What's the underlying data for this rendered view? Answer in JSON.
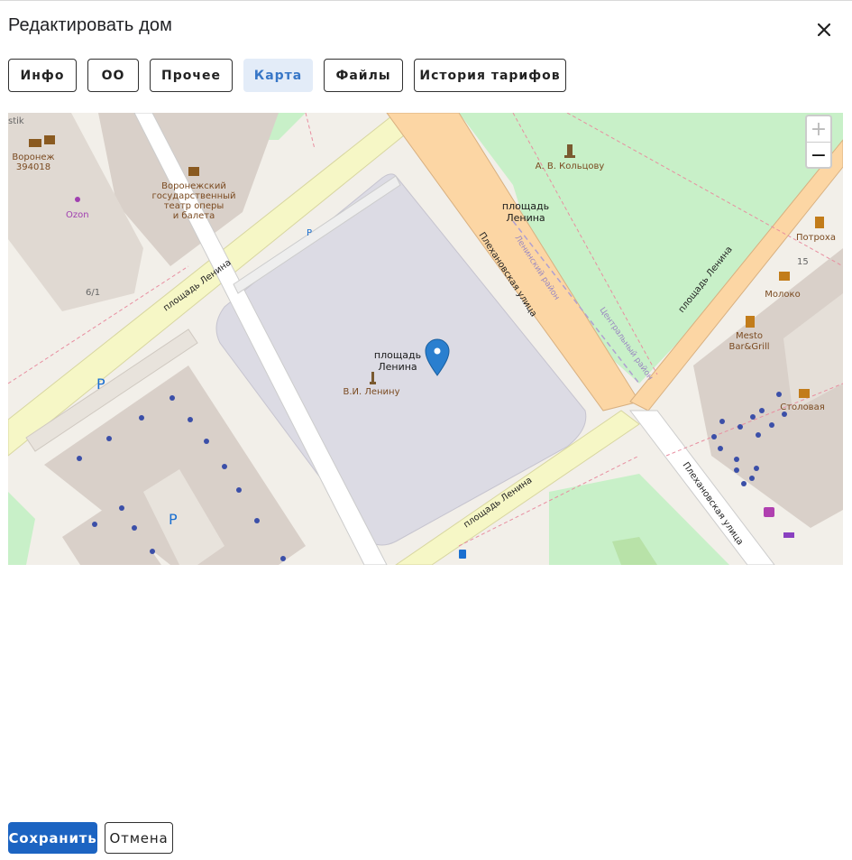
{
  "dialog": {
    "title": "Редактировать дом",
    "close_icon": "close-icon"
  },
  "tabs": [
    {
      "label": "Инфо",
      "active": false
    },
    {
      "label": "ОО",
      "active": false
    },
    {
      "label": "Прочее",
      "active": false
    },
    {
      "label": "Карта",
      "active": true
    },
    {
      "label": "Файлы",
      "active": false
    },
    {
      "label": "История тарифов",
      "active": false
    }
  ],
  "map": {
    "zoom_in": "+",
    "zoom_out": "−",
    "marker_icon": "map-pin-icon",
    "labels": {
      "square_center": "площадь Ленина",
      "square_center_l1": "площадь",
      "square_center_l2": "Ленина",
      "monument": "В.И. Ленину",
      "koltsov": "А. В. Кольцову",
      "square_top_l1": "площадь",
      "square_top_l2": "Ленина",
      "theatre_l1": "Воронежский",
      "theatre_l2": "государственный",
      "theatre_l3": "театр оперы",
      "theatre_l4": "и балета",
      "post_l1": "Воронеж",
      "post_l2": "394018",
      "ozon": "Ozon",
      "building_61": "6/1",
      "potroha": "Потроха",
      "house15": "15",
      "moloko": "Молоко",
      "mesto_l1": "Mesto",
      "mesto_l2": "Bar&Grill",
      "stolovaya": "Столовая",
      "plekhanovskaya": "Плехановская улица",
      "leninsky": "Ленинский район",
      "centralny": "Центральный район",
      "road_sq_1": "площадь Ленина",
      "road_sq_2": "площадь Ленина",
      "road_sq_3": "площадь Ленина",
      "corner_text": "stik",
      "parking": "P"
    }
  },
  "footer": {
    "save_label": "Сохранить",
    "cancel_label": "Отмена"
  },
  "colors": {
    "accent": "#1c64c2",
    "active_tab_bg": "#e3ecf8",
    "active_tab_text": "#3877c7",
    "marker": "#2a7fcf"
  }
}
